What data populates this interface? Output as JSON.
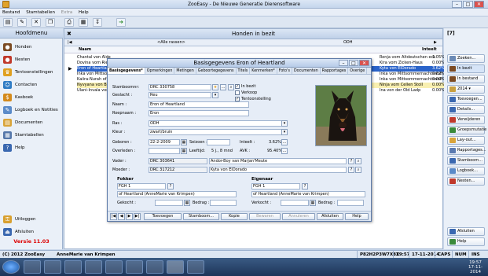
{
  "window": {
    "title": "ZooEasy - De Nieuwe Generatie Dierensoftware",
    "min": "–",
    "max": "□",
    "close": "✕"
  },
  "menu": [
    "Bestand",
    "Stamtabellen",
    "Extra",
    "Help"
  ],
  "left": {
    "title": "Hoofdmenu",
    "items": [
      "Honden",
      "Nesten",
      "Tentoonstellingen",
      "Contacten",
      "Kasboek",
      "Logboek en Notities",
      "Documenten",
      "Stamtabellen",
      "Help"
    ],
    "bottom_items": [
      "Uitloggen",
      "Afsluiten"
    ],
    "version": "Versie 11.03"
  },
  "main": {
    "title": "Honden in bezit",
    "tab_left": "<Alle rassen>",
    "tab_right": "ODH",
    "col_name": "Naam",
    "col_right": "Inteelt",
    "rows": [
      {
        "name": "Chantal von Alde",
        "right": "Ronja vom Altdeutschen eck",
        "pct": "1.05%"
      },
      {
        "name": "Dovina vom Riedi",
        "right": "Kira vom Zicken-Haus",
        "pct": "0.00%"
      },
      {
        "name": "Eron of Heartlan",
        "right": "Kyta von ElDorado",
        "pct": "3.62%"
      },
      {
        "name": "Inka von Mittsom",
        "right": "Inka von Mittsommernachtswolf",
        "pct": "0.62%"
      },
      {
        "name": "Kaiira-Nurah of H",
        "right": "Inka von Mittsommernachtswolf",
        "pct": "0.00%"
      },
      {
        "name": "Nyvyana von Bün",
        "right": "Ninja vom Cellen Stoll",
        "pct": "0.00%"
      },
      {
        "name": "Ulani-Invala von D",
        "right": "Ina von der Old Ladp",
        "pct": "0.00%"
      }
    ]
  },
  "right_panel": {
    "count": "[7]",
    "buttons": [
      "Zoeken...",
      "In bezit",
      "In bestand",
      "2014",
      "Toevoegen...",
      "Details...",
      "Verwijderen",
      "Groepsmutatie",
      "Lay-out...",
      "Rapportages...",
      "Stamboom...",
      "Logboek...",
      "Nesten..."
    ],
    "bottom_buttons": [
      "Afsluiten",
      "Help"
    ]
  },
  "dialog": {
    "title": "Basisgegevens Eron of Heartland",
    "tabs": [
      "Basisgegevens*",
      "Opmerkingen",
      "Metingen",
      "Geboortegegevens",
      "Titels",
      "Kenmerken*",
      "Foto's",
      "Documenten",
      "Rapportages",
      "Overige"
    ],
    "fields": {
      "stamboomnr_label": "Stamboomnr:",
      "stamboomnr": "DRC 330758",
      "geslacht_label": "Geslacht :",
      "geslacht": "Reu",
      "naam_label": "Naam :",
      "naam": "Eron of Heartland",
      "roepnaam_label": "Roepnaam :",
      "roepnaam": "Eron",
      "ras_label": "Ras :",
      "ras": "ODH",
      "kleur_label": "Kleur :",
      "kleur": "zwart/bruin",
      "geboren_label": "Geboren :",
      "geboren": "22-2-2009",
      "seizoen_label": "Seizoen :",
      "inteelt_label": "Inteelt :",
      "inteelt": "3.62%",
      "overleden_label": "Overleden :",
      "leeftijd_label": "Leeftijd:",
      "leeftijd": "5 j., 8 mnd",
      "avk_label": "AVK :",
      "avk": "95.40%",
      "vader_label": "Vader :",
      "vader_nr": "DRC 303641",
      "vader": "Andor-Boy van Marjan'Meute",
      "moeder_label": "Moeder :",
      "moeder_nr": "DRC 317212",
      "moeder": "Kyta von ElDorado"
    },
    "checks": {
      "in_bezit": "In bezit",
      "verkoop": "Verkoop",
      "tentoonstelling": "Tentoonstelling"
    },
    "fokker": {
      "title": "Fokker",
      "code": "FGH 1",
      "name": "of Heartland (AnneMarie van Krimpen)",
      "gekocht_label": "Gekocht :",
      "bedrag_label": "Bedrag :"
    },
    "eigenaar": {
      "title": "Eigenaar",
      "code": "FGH 1",
      "name": "of Heartland (AnneMarie van Krimpen)",
      "verkocht_label": "Verkocht :",
      "bedrag_label": "Bedrag :"
    },
    "buttons": [
      "Toevoegen",
      "Stamboom...",
      "Kopie",
      "Bewaren",
      "Annuleren",
      "Afsluiten",
      "Help"
    ]
  },
  "status": {
    "copyright": "(C) 2012 ZooEasy",
    "user": "AnneMarie van Krimpen",
    "code": "P82H2P3W7X8X",
    "time": "19:57",
    "date": "17-11-2014",
    "caps": "CAPS",
    "num": "NUM",
    "ins": "INS"
  },
  "taskbar": {
    "clock_time": "19:57",
    "clock_date": "17-11-2014"
  }
}
